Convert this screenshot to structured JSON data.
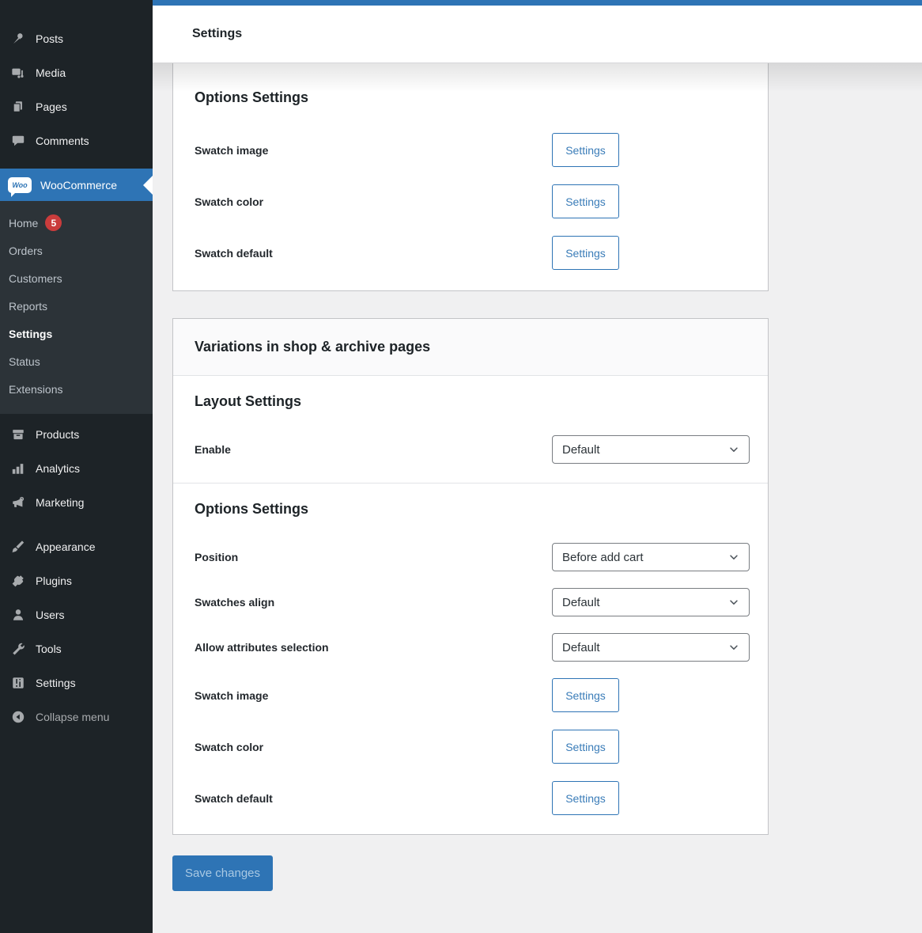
{
  "header": {
    "title": "Settings"
  },
  "colors": {
    "accent_blue": "#2e74b5",
    "badge_red": "#ca3c3c",
    "sidebar_bg": "#1d2327",
    "submenu_bg": "#2c3338"
  },
  "sidebar": {
    "items_top": [
      {
        "label": "Posts"
      },
      {
        "label": "Media"
      },
      {
        "label": "Pages"
      },
      {
        "label": "Comments"
      }
    ],
    "woocommerce": {
      "label": "WooCommerce",
      "icon_text": "Woo"
    },
    "submenu": [
      {
        "label": "Home",
        "badge": "5"
      },
      {
        "label": "Orders"
      },
      {
        "label": "Customers"
      },
      {
        "label": "Reports"
      },
      {
        "label": "Settings"
      },
      {
        "label": "Status"
      },
      {
        "label": "Extensions"
      }
    ],
    "items_mid": [
      {
        "label": "Products"
      },
      {
        "label": "Analytics"
      },
      {
        "label": "Marketing"
      }
    ],
    "items_low": [
      {
        "label": "Appearance"
      },
      {
        "label": "Plugins"
      },
      {
        "label": "Users"
      },
      {
        "label": "Tools"
      },
      {
        "label": "Settings"
      }
    ],
    "collapse_label": "Collapse menu"
  },
  "panel_options_top": {
    "heading": "Options Settings",
    "rows": [
      {
        "label": "Swatch image",
        "button": "Settings"
      },
      {
        "label": "Swatch color",
        "button": "Settings"
      },
      {
        "label": "Swatch default",
        "button": "Settings"
      }
    ]
  },
  "panel_variations": {
    "band_title": "Variations in shop & archive pages",
    "layout": {
      "heading": "Layout Settings",
      "rows": [
        {
          "label": "Enable",
          "select_value": "Default"
        }
      ]
    },
    "options": {
      "heading": "Options Settings",
      "select_rows": [
        {
          "label": "Position",
          "select_value": "Before add cart"
        },
        {
          "label": "Swatches align",
          "select_value": "Default"
        },
        {
          "label": "Allow attributes selection",
          "select_value": "Default"
        }
      ],
      "button_rows": [
        {
          "label": "Swatch image",
          "button": "Settings"
        },
        {
          "label": "Swatch color",
          "button": "Settings"
        },
        {
          "label": "Swatch default",
          "button": "Settings"
        }
      ]
    }
  },
  "save_button": {
    "label": "Save changes"
  }
}
